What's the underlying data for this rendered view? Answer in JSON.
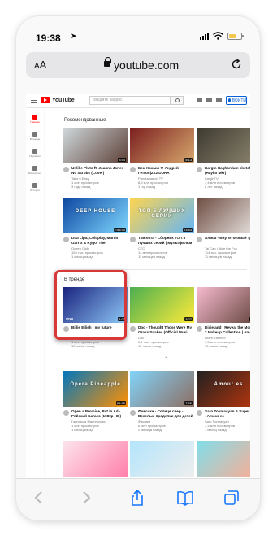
{
  "status": {
    "time": "19:38"
  },
  "browser": {
    "text_size_label": "AA",
    "url": "youtube.com"
  },
  "youtube": {
    "logo_text": "YouTube",
    "search_placeholder": "Введите запрос",
    "signin_label": "ВОЙТИ",
    "sidebar": [
      {
        "label": "Главная",
        "icon": "home-icon",
        "active": true
      },
      {
        "label": "В тренде",
        "icon": "fire-icon",
        "active": false
      },
      {
        "label": "Подписки",
        "icon": "subscriptions-icon",
        "active": false
      },
      {
        "label": "Библиотека",
        "icon": "library-icon",
        "active": false
      },
      {
        "label": "История",
        "icon": "history-icon",
        "active": false
      }
    ],
    "recommended_title": "Рекомендованные",
    "recommended": [
      {
        "title": "Unlike Pluto ft. Joanna Jones - No Scrubs (Cover)",
        "channel": "Take it Easy",
        "views": "1 млн просмотров",
        "age": "3 года назад",
        "duration": "3:54",
        "thumb_a": "#cfd8dc",
        "thumb_b": "#5d4037"
      },
      {
        "title": "Бец Ханыш Ф Андрей Гетгол|2X2 DURA",
        "channel": "Pandiamarion TV",
        "views": "8,5 млн просмотров",
        "age": "1 год назад",
        "duration": "5:13",
        "thumb_a": "#7b1f1f",
        "thumb_b": "#d7a86e"
      },
      {
        "title": "Kargin Haghordum sketch 551 (Hayko Mkr)",
        "channel": "KarginTV",
        "views": "1,4 млн просмотров",
        "age": "8 лет назад",
        "duration": "4:57",
        "thumb_a": "#3e3a30",
        "thumb_b": "#8d8670"
      },
      {
        "title": "Dua Lipa, Coldplay, Martin Garrix & Kygo, The Chainsmokers Sty...",
        "channel": "Queen Club",
        "views": "153 тыс. просмотров",
        "age": "1 месяц назад",
        "duration": "2:46:30",
        "thumb_a": "#0d47a1",
        "thumb_b": "#80d8ff",
        "thumb_text": "DEEP HOUSE"
      },
      {
        "title": "Три Кота - Сборник ТОП 5 Лучших серий | Мультфильм для...",
        "channel": "СТС",
        "views": "14 млн просмотров",
        "age": "11 месяцев назад",
        "duration": "23:43",
        "thumb_a": "#ffd54f",
        "thumb_b": "#64b5f6",
        "thumb_text": "ТОП 5 ЛУЧШИХ СЕРИЙ"
      },
      {
        "title": "Алиса - мяу. Итоговый треш",
        "channel": "Tai Cao | Alice the Fox",
        "views": "114 тыс. просмотров",
        "age": "11 месяцев назад",
        "duration": "0:22",
        "thumb_a": "#6d4c41",
        "thumb_b": "#efebe9"
      }
    ],
    "trending_title": "В тренде",
    "trending": [
      {
        "title": "Billie Eilish - my future",
        "channel": "Billie Eilish",
        "views": "1 млн просмотров",
        "age": "10 часов назад",
        "duration": "4:00",
        "thumb_a": "#1a237e",
        "thumb_b": "#90caf9",
        "badge": "vevo"
      },
      {
        "title": "Doc - Thought Those Were My Grass Snakes (Official Musi...",
        "channel": "Doc",
        "views": "2,4 тыс. просмотров",
        "age": "12 часов назад",
        "duration": "3:27",
        "thumb_a": "#4caf50",
        "thumb_b": "#ffeb3b"
      },
      {
        "title": "Dixie and I Reveal the Morphe 2 Makeup Collection | Amelie...",
        "channel": "charli d'amelio",
        "views": "1,5 млн просмотров",
        "age": "15 часов назад",
        "duration": "10:14",
        "thumb_a": "#f8bbd0",
        "thumb_b": "#5d4037"
      },
      {
        "title": "Open a Promise, Put in Ad - Ряйский Багаиз (1080p HD)",
        "channel": "Гагеовкая Мастерская",
        "views": "1 млн просмотров",
        "age": "1 месяц назад",
        "duration": "21:05",
        "thumb_a": "#0277bd",
        "thumb_b": "#ff8f00",
        "thumb_text": "Opera Pineapple"
      },
      {
        "title": "Фиксики - Солнце свер - Веселые проделки для детей",
        "channel": "Фиксики",
        "views": "6 млн просмотров",
        "age": "2 месяца назад",
        "duration": "7:02",
        "thumb_a": "#81d4fa",
        "thumb_b": "#8d6e63"
      },
      {
        "title": "Saro Tovmasyan & Super Sako - Amour es",
        "channel": "Saro Tovmasyan",
        "views": "1,4 млн просмотров",
        "age": "1 месяц назад",
        "duration": "3:41",
        "thumb_a": "#212121",
        "thumb_b": "#bf360c",
        "thumb_text": "Amour es"
      },
      {
        "title": "",
        "channel": "",
        "views": "",
        "age": "",
        "duration": "",
        "thumb_a": "#fce4ec",
        "thumb_b": "#ff80ab"
      },
      {
        "title": "",
        "channel": "",
        "views": "",
        "age": "",
        "duration": "",
        "thumb_a": "#b3e5fc",
        "thumb_b": "#eeeeee"
      },
      {
        "title": "",
        "channel": "",
        "views": "",
        "age": "",
        "duration": "",
        "thumb_a": "#80deea",
        "thumb_b": "#ffab91"
      }
    ]
  },
  "colors": {
    "accent": "#ff0000",
    "link": "#065fd4",
    "highlight": "#d93838",
    "safari_blue": "#1677ff"
  }
}
